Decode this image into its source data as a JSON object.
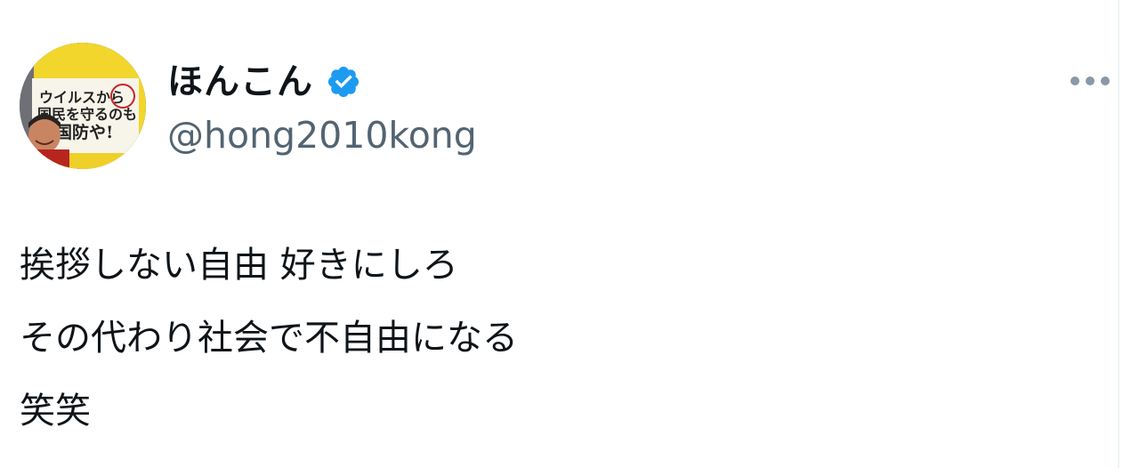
{
  "tweet": {
    "author": {
      "display_name": "ほんこん",
      "handle": "@hong2010kong",
      "verified": true,
      "avatar_icon": "profile-photo"
    },
    "more_icon": "more-horizontal-icon",
    "text_lines": [
      "挨拶しない自由 好きにしろ",
      "その代わり社会で不自由になる",
      "笑笑"
    ],
    "avatar_book_text": {
      "line1": "ウイルスから",
      "line2": "国民を守るのも",
      "line3": "国防や!"
    }
  },
  "colors": {
    "text": "#0f1419",
    "secondary": "#536471",
    "verified": "#1d9bf0",
    "more_dots": "#8b98a5"
  }
}
